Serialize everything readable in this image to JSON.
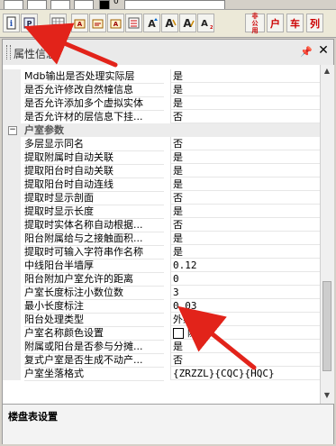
{
  "topbar": {
    "value_text": "0"
  },
  "toolbar": {
    "left_icons": [
      "info-icon",
      "pointer-icon",
      "grid-icon",
      "text-style-icon",
      "text-edit-icon",
      "text-bold-icon",
      "text-list-icon",
      "text-up-icon",
      "text-a-icon",
      "text-a2-icon",
      "text-sub-icon"
    ],
    "right_labels": {
      "public": "非公用",
      "household": "户",
      "car": "车",
      "column": "列"
    }
  },
  "panel": {
    "title": "属性信息",
    "pin": "📌",
    "close": "✕",
    "rows_top": [
      {
        "name": "Mdb输出是否处理实际层",
        "value": "是"
      },
      {
        "name": "是否允许修改自然幢信息",
        "value": "是"
      },
      {
        "name": "是否允许添加多个虚拟实体",
        "value": "是"
      },
      {
        "name": "是否允许材的层信息下挂...",
        "value": "否"
      }
    ],
    "category": {
      "toggle": "−",
      "name": "户室参数"
    },
    "rows": [
      {
        "name": "多层显示同名",
        "value": "否"
      },
      {
        "name": "提取附属时自动关联",
        "value": "是"
      },
      {
        "name": "提取阳台时自动关联",
        "value": "是"
      },
      {
        "name": "提取阳台时自动连线",
        "value": "是"
      },
      {
        "name": "提取时显示剖面",
        "value": "否"
      },
      {
        "name": "提取时显示长度",
        "value": "是"
      },
      {
        "name": "提取时实体名称自动根据...",
        "value": "否"
      },
      {
        "name": "阳台附属给与之接触面积...",
        "value": "是"
      },
      {
        "name": "提取时可输入字符串作名称",
        "value": "是"
      },
      {
        "name": "中线阳台半墙厚",
        "value": "0.12"
      },
      {
        "name": "阳台附加户室允许的距离",
        "value": "0"
      },
      {
        "name": "户室长度标注小数位数",
        "value": "3"
      },
      {
        "name": "最小长度标注",
        "value": "0.03"
      },
      {
        "name": "阳台处理类型",
        "value": "外线阳台"
      },
      {
        "name": "户室名称颜色设置",
        "value": "随块"
      },
      {
        "name": "附属或阳台是否参与分摊...",
        "value": "是"
      },
      {
        "name": "复式户室是否生成不动产...",
        "value": "否"
      },
      {
        "name": "户室坐落格式",
        "value": "{ZRZZL}{CQC}{HQC}"
      }
    ],
    "description_title": "楼盘表设置"
  }
}
